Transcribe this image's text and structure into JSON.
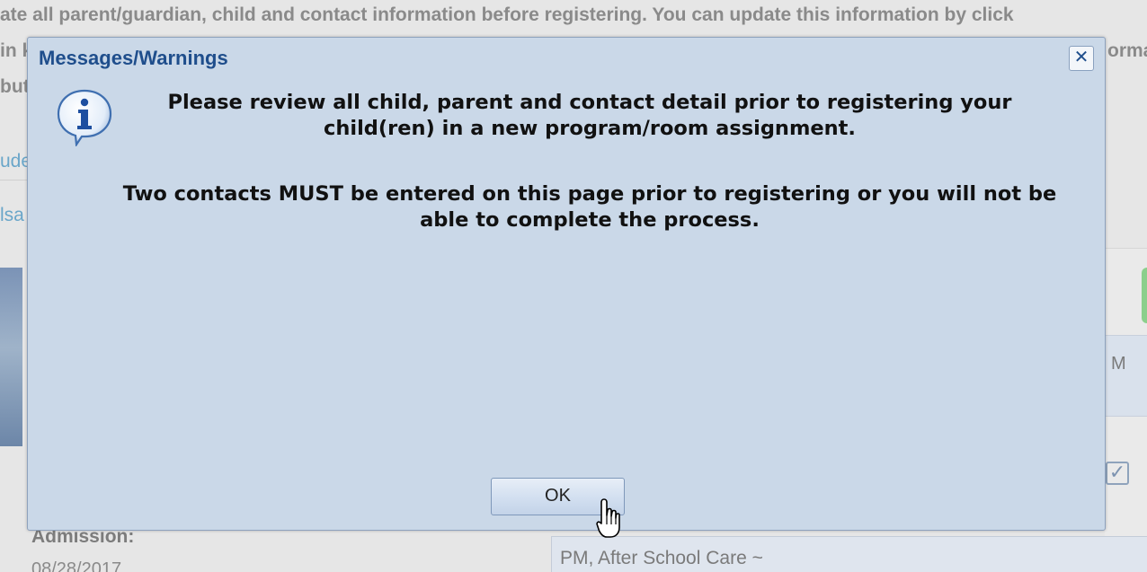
{
  "background": {
    "instruction_line_1": "ate all parent/guardian, child and contact information before registering. You can update this information by click",
    "instruction_line_2": "in k",
    "instruction_line_2_right": "orma",
    "instruction_line_3": "but",
    "link_1": "ude",
    "link_2": "lsa",
    "grid_header_fragment": "M",
    "admission_label": "Admission:",
    "admission_date": "08/28/2017",
    "program_text": "PM, After School Care ~"
  },
  "dialog": {
    "title": "Messages/Warnings",
    "close_glyph": "✕",
    "icon": "info-icon",
    "message_1": "Please review all child, parent and contact detail prior to registering your child(ren) in a new program/room assignment.",
    "message_2": "Two contacts MUST be entered on this page prior to registering or you will not be able to complete the process.",
    "ok_label": "OK"
  },
  "colors": {
    "dialog_bg": "#cad8e8",
    "title_color": "#1f4e8c",
    "border": "#8ea2bd"
  }
}
